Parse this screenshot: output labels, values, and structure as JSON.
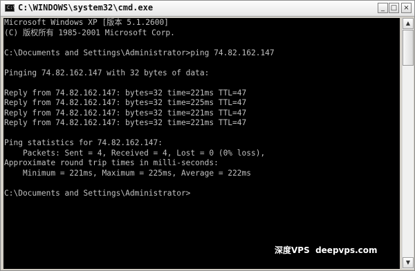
{
  "window": {
    "title": "C:\\WINDOWS\\system32\\cmd.exe",
    "icon": "cmd-icon",
    "controls": {
      "minimize": "_",
      "maximize": "□",
      "close": "×"
    }
  },
  "console": {
    "lines": [
      "Microsoft Windows XP [版本 5.1.2600]",
      "(C) 版权所有 1985-2001 Microsoft Corp.",
      "",
      "C:\\Documents and Settings\\Administrator>ping 74.82.162.147",
      "",
      "Pinging 74.82.162.147 with 32 bytes of data:",
      "",
      "Reply from 74.82.162.147: bytes=32 time=221ms TTL=47",
      "Reply from 74.82.162.147: bytes=32 time=225ms TTL=47",
      "Reply from 74.82.162.147: bytes=32 time=221ms TTL=47",
      "Reply from 74.82.162.147: bytes=32 time=221ms TTL=47",
      "",
      "Ping statistics for 74.82.162.147:",
      "    Packets: Sent = 4, Received = 4, Lost = 0 (0% loss),",
      "Approximate round trip times in milli-seconds:",
      "    Minimum = 221ms, Maximum = 225ms, Average = 222ms",
      "",
      "C:\\Documents and Settings\\Administrator>"
    ]
  },
  "scrollbar": {
    "up_arrow": "▲",
    "down_arrow": "▼"
  },
  "watermark": {
    "text": "深度VPS  deepvps.com"
  }
}
